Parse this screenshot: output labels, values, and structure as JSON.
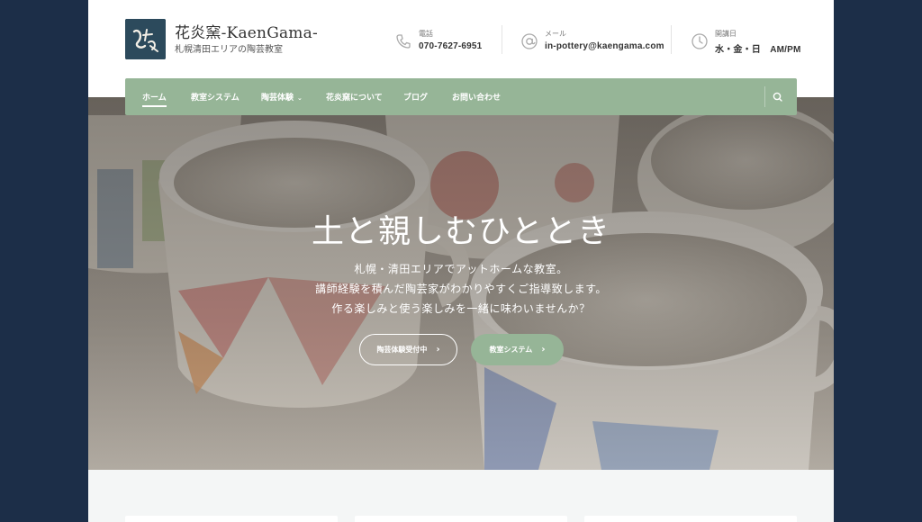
{
  "site": {
    "title": "花炎窯-KaenGama-",
    "tagline": "札幌清田エリアの陶芸教室"
  },
  "contact": {
    "phone_label": "電話",
    "phone": "070-7627-6951",
    "mail_label": "メール",
    "mail": "in-pottery@kaengama.com",
    "open_label": "開講日",
    "open_days": "水・金・日　AM/PM"
  },
  "nav": {
    "items": [
      {
        "label": "ホーム"
      },
      {
        "label": "教室システム"
      },
      {
        "label": "陶芸体験"
      },
      {
        "label": "花炎窯について"
      },
      {
        "label": "ブログ"
      },
      {
        "label": "お問い合わせ"
      }
    ]
  },
  "hero": {
    "title": "土と親しむひととき",
    "lines": [
      "札幌・清田エリアでアットホームな教室。",
      "講師経験を積んだ陶芸家がわかりやすくご指導致します。",
      "作る楽しみと使う楽しみを一緒に味わいませんか？"
    ],
    "button_primary": "陶芸体験受付中",
    "button_secondary": "教室システム"
  },
  "colors": {
    "accent": "#96b597",
    "frame": "#1c2e48",
    "logo_bg": "#2c4a5c"
  },
  "icons": {
    "phone": "phone-icon",
    "mail": "at-sign-icon",
    "clock": "clock-icon",
    "search": "search-icon",
    "chevron": "chevron-right-icon",
    "caret": "chevron-down-icon"
  }
}
